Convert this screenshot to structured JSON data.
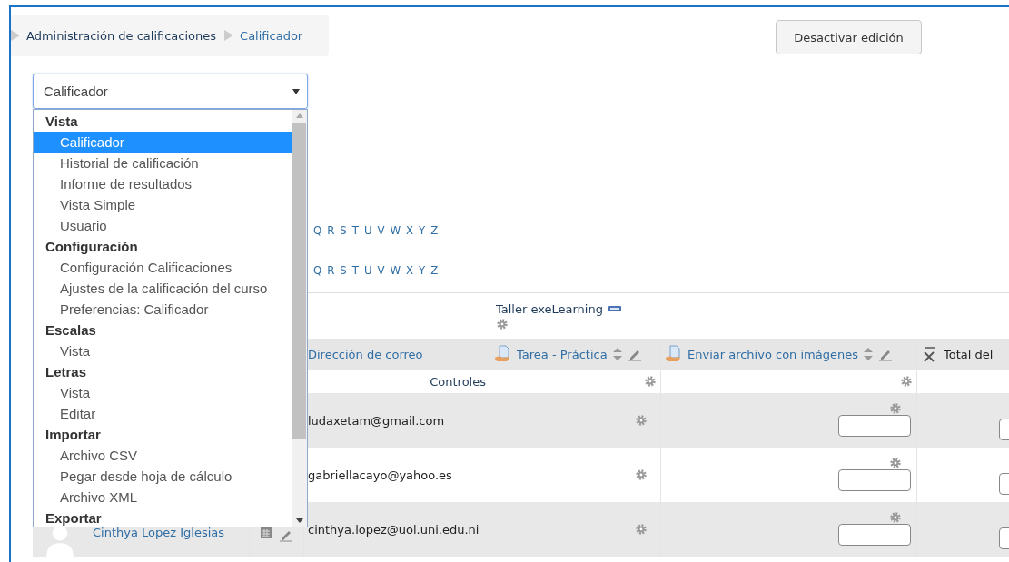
{
  "breadcrumb": [
    {
      "label": "Administración de calificaciones"
    },
    {
      "label": "Calificador"
    }
  ],
  "edit_button": "Desactivar edición",
  "report_select": {
    "value": "Calificador",
    "expanded": true,
    "groups": [
      {
        "label": "Vista",
        "items": [
          {
            "label": "Calificador",
            "selected": true
          },
          {
            "label": "Historial de calificación",
            "selected": false
          },
          {
            "label": "Informe de resultados",
            "selected": false
          },
          {
            "label": "Vista Simple",
            "selected": false
          },
          {
            "label": "Usuario",
            "selected": false
          }
        ]
      },
      {
        "label": "Configuración",
        "items": [
          {
            "label": "Configuración Calificaciones",
            "selected": false
          },
          {
            "label": "Ajustes de la calificación del curso",
            "selected": false
          },
          {
            "label": "Preferencias: Calificador",
            "selected": false
          }
        ]
      },
      {
        "label": "Escalas",
        "items": [
          {
            "label": "Vista",
            "selected": false
          }
        ]
      },
      {
        "label": "Letras",
        "items": [
          {
            "label": "Vista",
            "selected": false
          },
          {
            "label": "Editar",
            "selected": false
          }
        ]
      },
      {
        "label": "Importar",
        "items": [
          {
            "label": "Archivo CSV",
            "selected": false
          },
          {
            "label": "Pegar desde hoja de cálculo",
            "selected": false
          },
          {
            "label": "Archivo XML",
            "selected": false
          }
        ]
      },
      {
        "label": "Exportar"
      }
    ]
  },
  "letter_filters": [
    [
      "Q",
      "R",
      "S",
      "T",
      "U",
      "V",
      "W",
      "X",
      "Y",
      "Z"
    ],
    [
      "Q",
      "R",
      "S",
      "T",
      "U",
      "V",
      "W",
      "X",
      "Y",
      "Z"
    ]
  ],
  "table": {
    "category": "Taller exeLearning",
    "controls_label": "Controles",
    "columns": [
      {
        "label": "Dirección de correo",
        "kind": "email"
      },
      {
        "label": "Tarea - Práctica",
        "kind": "assignment"
      },
      {
        "label": "Enviar archivo con imágenes",
        "kind": "assignment"
      },
      {
        "label": "Total del",
        "kind": "total"
      }
    ],
    "rows": [
      {
        "email": "ludaxetam@gmail.com"
      },
      {
        "email": "gabriellacayo@yahoo.es"
      },
      {
        "name": "Cinthya Lopez Iglesias",
        "email": "cinthya.lopez@uol.uni.edu.ni"
      }
    ]
  }
}
